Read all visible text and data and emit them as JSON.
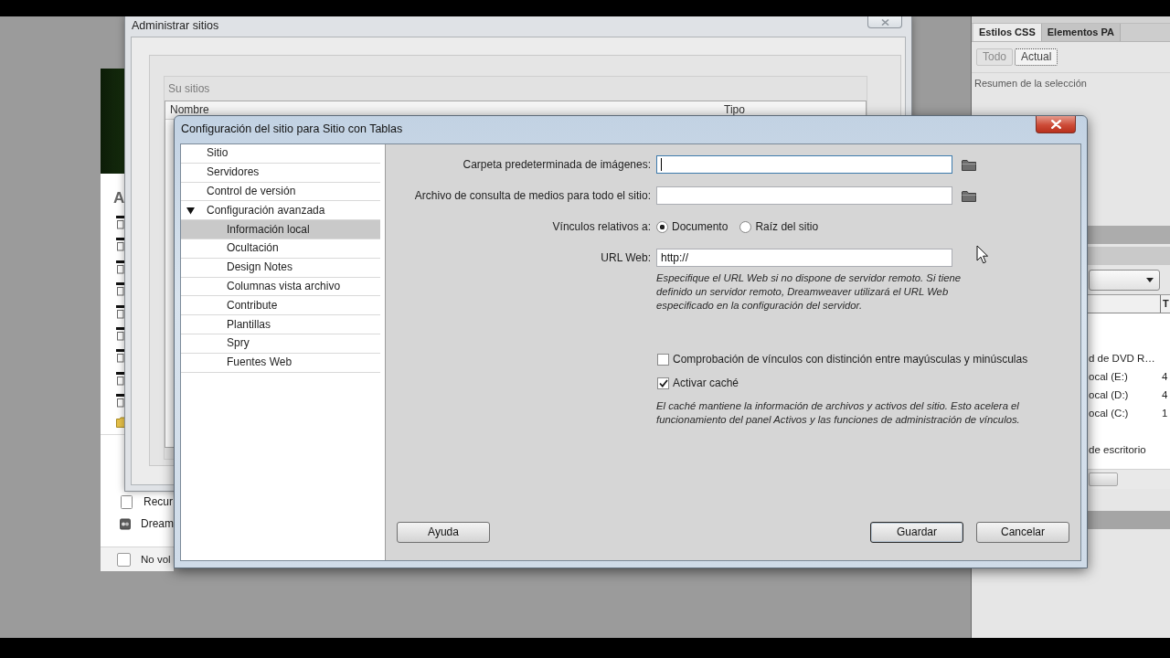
{
  "manage_sites": {
    "title": "Administrar sitios",
    "group_label": "Su sitios",
    "columns": [
      "Nombre",
      "Tipo"
    ]
  },
  "start_page": {
    "heading": "A",
    "links": [
      {
        "label": "Recur",
        "kind": "page"
      },
      {
        "label": "Dream",
        "kind": "app"
      }
    ],
    "dont_show": {
      "label": "No vol",
      "checked": false
    }
  },
  "css_panel": {
    "tabs": [
      {
        "label": "Estilos CSS",
        "selected": true
      },
      {
        "label": "Elementos PA",
        "selected": false
      }
    ],
    "modes": [
      {
        "label": "Todo",
        "selected": false
      },
      {
        "label": "Actual",
        "selected": true
      }
    ],
    "summary_label": "Resumen de la selección"
  },
  "files_panel": {
    "columns": [
      "T"
    ],
    "rows": [
      {
        "name": "d de DVD R…"
      },
      {
        "name": "ocal (E:)",
        "column_2": "4"
      },
      {
        "name": "ocal (D:)",
        "column_2": "4"
      },
      {
        "name": "ocal (C:)",
        "column_2": "1"
      },
      {
        "name": "de escritorio"
      }
    ]
  },
  "site_setup": {
    "title": "Configuración del sitio para Sitio con Tablas",
    "categories": [
      {
        "label": "Sitio",
        "selected": false
      },
      {
        "label": "Servidores",
        "selected": false
      },
      {
        "label": "Control de versión",
        "selected": false
      },
      {
        "label": "Configuración avanzada",
        "selected": false,
        "expanded": true,
        "children": [
          {
            "label": "Información local",
            "selected": true
          },
          {
            "label": "Ocultación",
            "selected": false
          },
          {
            "label": "Design Notes",
            "selected": false
          },
          {
            "label": "Columnas vista archivo",
            "selected": false
          },
          {
            "label": "Contribute",
            "selected": false
          },
          {
            "label": "Plantillas",
            "selected": false
          },
          {
            "label": "Spry",
            "selected": false
          },
          {
            "label": "Fuentes Web",
            "selected": false
          }
        ]
      }
    ],
    "fields": [
      {
        "kind": "path",
        "label": "Carpeta predeterminada de imágenes:",
        "focused": true
      },
      {
        "kind": "path",
        "label": "Archivo de consulta de medios para todo el sitio:",
        "focused": false
      },
      {
        "kind": "radio",
        "label": "Vínculos relativos a:",
        "options": [
          {
            "label": "Documento",
            "selected": true
          },
          {
            "label": "Raíz del sitio",
            "selected": false
          }
        ]
      },
      {
        "kind": "text",
        "label": "URL Web:",
        "value": "http://",
        "focused": false
      }
    ],
    "url_hint": "Especifique el URL Web si no dispone de servidor remoto. Si tiene definido un servidor remoto, Dreamweaver utilizará el URL Web especificado en la configuración del servidor.",
    "checkboxes": [
      {
        "label": "Comprobación de vínculos con distinción entre mayúsculas y minúsculas",
        "checked": false
      },
      {
        "label": "Activar caché",
        "checked": true
      }
    ],
    "cache_hint": "El caché mantiene la información de archivos y activos del sitio. Esto acelera el funcionamiento del panel Activos y las funciones de administración de vínculos.",
    "help_button": {
      "label": "Ayuda"
    },
    "buttons": [
      {
        "label": "Guardar",
        "default": true
      },
      {
        "label": "Cancelar",
        "default": false
      }
    ]
  }
}
